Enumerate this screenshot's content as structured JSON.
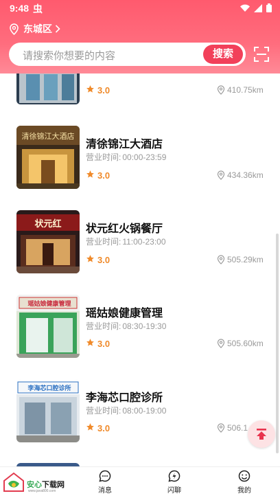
{
  "status": {
    "time": "9:48",
    "indicator": "虫"
  },
  "header": {
    "location": "东城区",
    "search_placeholder": "请搜索你想要的内容",
    "search_button": "搜索"
  },
  "hours_label": "营业时间:",
  "items": [
    {
      "name": "",
      "hours": "",
      "rating": "3.0",
      "distance": "410.75km"
    },
    {
      "name": "清徐锦江大酒店",
      "hours": "00:00-23:59",
      "rating": "3.0",
      "distance": "434.36km",
      "sign": "清徐锦江大酒店"
    },
    {
      "name": "状元红火锅餐厅",
      "hours": "11:00-23:00",
      "rating": "3.0",
      "distance": "505.29km",
      "sign": "状元红"
    },
    {
      "name": "瑶姑娘健康管理",
      "hours": "08:30-19:30",
      "rating": "3.0",
      "distance": "505.60km",
      "sign": "瑶姑娘健康管理"
    },
    {
      "name": "李海芯口腔诊所",
      "hours": "08:00-19:00",
      "rating": "3.0",
      "distance": "506.1",
      "sign": "李海芯口腔诊所"
    }
  ],
  "tabs": [
    {
      "label": "消息"
    },
    {
      "label": "闪聊"
    },
    {
      "label": "我的"
    }
  ],
  "watermark": {
    "brand_green": "安心",
    "brand_dark": "下载网",
    "url": "www.java800.com"
  },
  "colors": {
    "accent": "#f2405a",
    "rating": "#f08a2a"
  }
}
